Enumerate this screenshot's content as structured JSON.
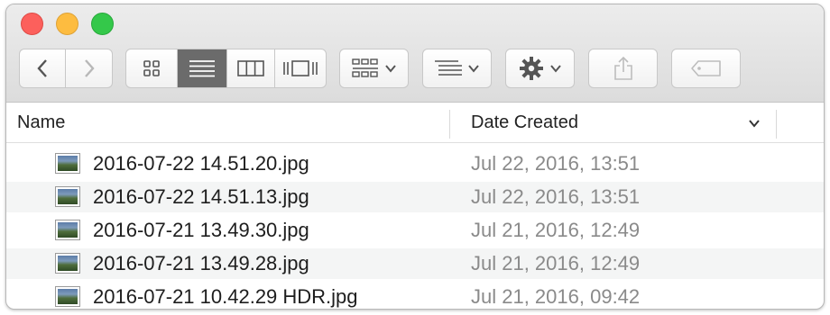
{
  "window": {
    "controls": [
      "close",
      "minimize",
      "zoom"
    ]
  },
  "toolbar": {
    "back_icon": "chevron-left-icon",
    "forward_icon": "chevron-right-icon",
    "view_modes": [
      "icon-view",
      "list-view",
      "column-view",
      "cover-flow-view"
    ],
    "active_view": "list-view",
    "arrange_icon": "grid-arrange-icon",
    "sort_icon": "list-sort-icon",
    "action_icon": "gear-icon",
    "share_icon": "share-icon",
    "tag_icon": "tag-icon"
  },
  "columns": {
    "name": "Name",
    "date": "Date Created"
  },
  "files": [
    {
      "name": "2016-07-22 14.51.20.jpg",
      "date": "Jul 22, 2016, 13:51"
    },
    {
      "name": "2016-07-22 14.51.13.jpg",
      "date": "Jul 22, 2016, 13:51"
    },
    {
      "name": "2016-07-21 13.49.30.jpg",
      "date": "Jul 21, 2016, 12:49"
    },
    {
      "name": "2016-07-21 13.49.28.jpg",
      "date": "Jul 21, 2016, 12:49"
    },
    {
      "name": "2016-07-21 10.42.29 HDR.jpg",
      "date": "Jul 21, 2016, 09:42"
    }
  ],
  "colors": {
    "close": "#fc605c",
    "minimize": "#fdbc40",
    "zoom": "#34c84a",
    "active_segment": "#6b6b6b",
    "date_text": "#8a8a8a"
  }
}
